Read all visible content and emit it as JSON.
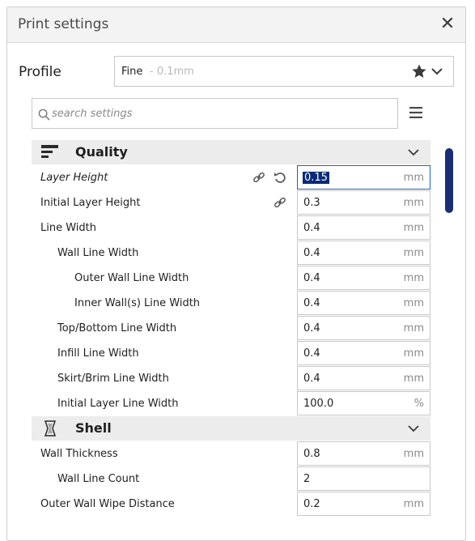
{
  "window": {
    "title": "Print settings"
  },
  "profile": {
    "label": "Profile",
    "name": "Fine",
    "sub": "- 0.1mm"
  },
  "search": {
    "placeholder": "search settings"
  },
  "sections": {
    "quality": {
      "label": "Quality"
    },
    "shell": {
      "label": "Shell"
    }
  },
  "rows": [
    {
      "label": "Layer Height",
      "value": "0.15",
      "unit": "mm"
    },
    {
      "label": "Initial Layer Height",
      "value": "0.3",
      "unit": "mm"
    },
    {
      "label": "Line Width",
      "value": "0.4",
      "unit": "mm"
    },
    {
      "label": "Wall Line Width",
      "value": "0.4",
      "unit": "mm"
    },
    {
      "label": "Outer Wall Line Width",
      "value": "0.4",
      "unit": "mm"
    },
    {
      "label": "Inner Wall(s) Line Width",
      "value": "0.4",
      "unit": "mm"
    },
    {
      "label": "Top/Bottom Line Width",
      "value": "0.4",
      "unit": "mm"
    },
    {
      "label": "Infill Line Width",
      "value": "0.4",
      "unit": "mm"
    },
    {
      "label": "Skirt/Brim Line Width",
      "value": "0.4",
      "unit": "mm"
    },
    {
      "label": "Initial Layer Line Width",
      "value": "100.0",
      "unit": "%"
    },
    {
      "label": "Wall Thickness",
      "value": "0.8",
      "unit": "mm"
    },
    {
      "label": "Wall Line Count",
      "value": "2",
      "unit": ""
    },
    {
      "label": "Outer Wall Wipe Distance",
      "value": "0.2",
      "unit": "mm"
    }
  ],
  "icons": {
    "close": "close-icon",
    "star": "star-icon",
    "chevron": "chevron-down-icon",
    "search": "search-icon",
    "menu": "menu-icon",
    "link": "link-icon",
    "reset": "reset-icon",
    "quality": "quality-icon",
    "shell": "shell-icon"
  },
  "colors": {
    "accent": "#1b2e73",
    "selection": "#0a2a78",
    "active_border": "#1f5fbf"
  }
}
